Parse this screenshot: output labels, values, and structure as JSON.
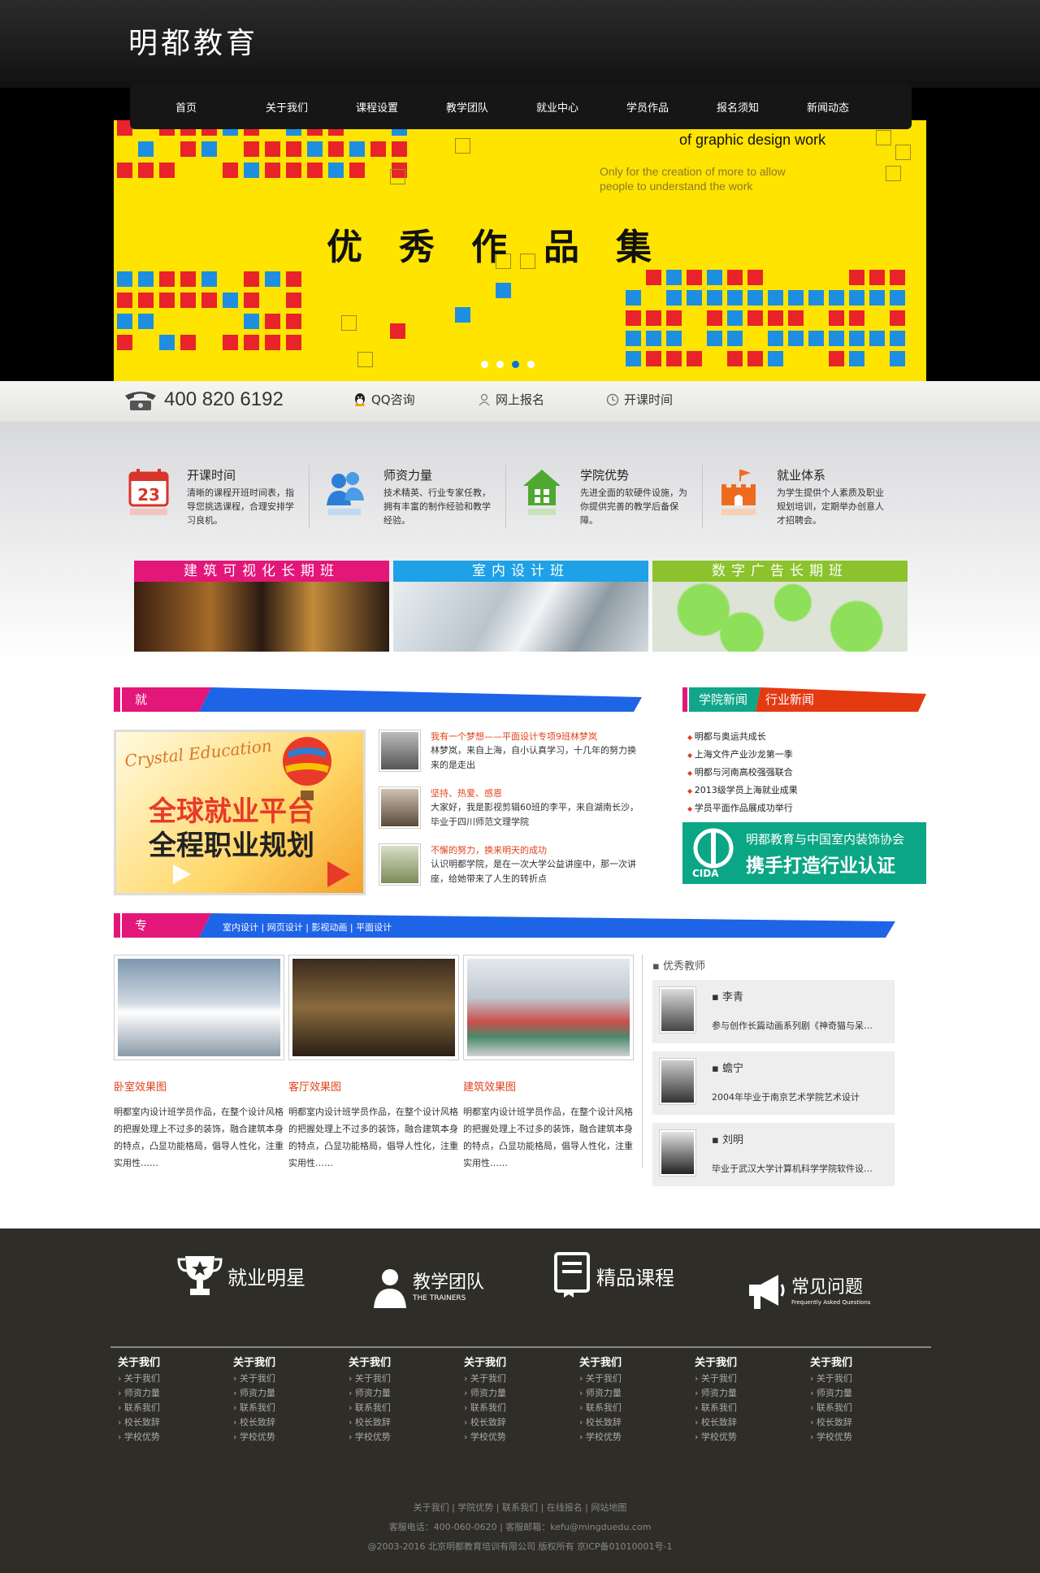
{
  "site": {
    "logo": "明都教育",
    "nav": [
      "首页",
      "关于我们",
      "课程设置",
      "教学团队",
      "就业中心",
      "学员作品",
      "报名须知",
      "新闻动态"
    ]
  },
  "banner": {
    "title": "优秀作品集",
    "subtitle": "of graphic design work",
    "tagline": "Only for the creation of more to allow people to understand the work",
    "slides": 4,
    "active_slide": 3
  },
  "contact": {
    "phone": "400 820 6192",
    "qq": "QQ咨询",
    "signup": "网上报名",
    "schedule": "开课时间"
  },
  "features": [
    {
      "icon": "calendar-icon",
      "title": "开课时间",
      "desc": "清晰的课程开班时间表，指导您挑选课程，合理安排学习良机。",
      "color": "#d9352a"
    },
    {
      "icon": "team-icon",
      "title": "师资力量",
      "desc": "技术精英、行业专家任教，拥有丰富的制作经验和教学经验。",
      "color": "#2b7fd6"
    },
    {
      "icon": "school-icon",
      "title": "学院优势",
      "desc": "先进全面的软硬件设施，为你提供完善的教学后备保障。",
      "color": "#4fa832"
    },
    {
      "icon": "castle-icon",
      "title": "就业体系",
      "desc": "为学生提供个人素质及职业规划培训，定期举办创意人才招聘会。",
      "color": "#ee6b1e"
    }
  ],
  "courses": [
    {
      "label": "建筑可视化长期班",
      "color": "#e3167a"
    },
    {
      "label": "室内设计班",
      "color": "#1ea1e6"
    },
    {
      "label": "数字广告长期班",
      "color": "#8cc22b"
    }
  ],
  "employment": {
    "heading": "就业服务",
    "promo_brand": "Crystal Education",
    "promo_line1": "全球就业平台",
    "promo_line2": "全程职业规划",
    "news": [
      {
        "title": "我有一个梦想——平面设计专项9班林梦岚",
        "desc": "林梦岚，来自上海，自小认真学习，十几年的努力换来的是走出"
      },
      {
        "title": "坚持、热爱、感恩",
        "desc": "大家好，我是影视剪辑60班的李平，来自湖南长沙，毕业于四川师范文理学院"
      },
      {
        "title": "不懈的努力，换来明天的成功",
        "desc": "认识明都学院，是在一次大学公益讲座中，那一次讲座，给她带来了人生的转折点"
      }
    ]
  },
  "college": {
    "tab1": "学院新闻",
    "tab2": "行业新闻",
    "news": [
      "明都与奥运共成长",
      "上海文件产业沙龙第一季",
      "明都与河南高校强强联合",
      "2013级学员上海就业成果",
      "学员平面作品展成功举行"
    ],
    "cida_text": "明都教育与中国室内装饰协会",
    "cida_slogan": "携手打造行业认证",
    "cida_abbr": "CIDA"
  },
  "professional": {
    "heading": "专业风采",
    "links": "室内设计 | 网页设计 | 影视动画 | 平面设计",
    "works": [
      {
        "title": "卧室效果图",
        "desc": "明都室内设计班学员作品，在整个设计风格的把握处理上不过多的装饰，融合建筑本身的特点，凸显功能格局，倡导人性化，注重实用性……"
      },
      {
        "title": "客厅效果图",
        "desc": "明都室内设计班学员作品，在整个设计风格的把握处理上不过多的装饰，融合建筑本身的特点，凸显功能格局，倡导人性化，注重实用性……"
      },
      {
        "title": "建筑效果图",
        "desc": "明都室内设计班学员作品，在整个设计风格的把握处理上不过多的装饰，融合建筑本身的特点，凸显功能格局，倡导人性化，注重实用性……"
      }
    ],
    "teachers_heading": "优秀教师",
    "teachers": [
      {
        "name": "李青",
        "desc": "参与创作长篇动画系列剧《神奇猫与呆…"
      },
      {
        "name": "蟾宁",
        "desc": "2004年毕业于南京艺术学院艺术设计"
      },
      {
        "name": "刘明",
        "desc": "毕业于武汉大学计算机科学学院软件设…"
      }
    ]
  },
  "footer": {
    "badges": [
      {
        "label": "就业明星",
        "sub": ""
      },
      {
        "label": "教学团队",
        "sub": "THE TRAINERS"
      },
      {
        "label": "精品课程",
        "sub": ""
      },
      {
        "label": "常见问题",
        "sub": "Frequently Asked Questions"
      }
    ],
    "column_heading": "关于我们",
    "column_links": [
      "关于我们",
      "师资力量",
      "联系我们",
      "校长致辞",
      "学校优势"
    ],
    "links": "关于我们 | 学院优势 | 联系我们 | 在线报名 | 网站地图",
    "contact": "客服电话：400-060-0620 | 客服邮箱：kefu@mingduedu.com",
    "copyright": "@2003-2016 北京明都教育培训有限公司 版权所有 京ICP备01010001号-1"
  }
}
